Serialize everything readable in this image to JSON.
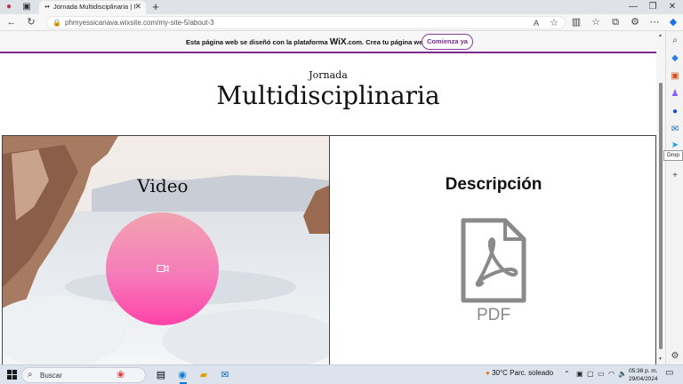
{
  "browser": {
    "tab_title": "Jornada Multidisciplinaria | My S",
    "url": "phmyessicanava.wixsite.com/my-site-5/about-3",
    "tooltip": "Drop"
  },
  "wix_banner": {
    "text_before": "Esta página web se diseñó con la plataforma ",
    "brand": "WiX",
    "text_after": ".com. Crea tu página web hoy.",
    "cta": "Comienza ya"
  },
  "page": {
    "kicker": "Jornada",
    "title": "Multidisciplinaria",
    "video_panel": {
      "title": "Video",
      "icon": "video-camera-icon"
    },
    "desc_panel": {
      "title": "Descripción",
      "file_label": "PDF",
      "icon": "pdf-file-icon"
    }
  },
  "taskbar": {
    "search_placeholder": "Buscar",
    "weather": "30°C  Parc. soleado",
    "time": "05:38 p. m.",
    "date": "29/04/2024"
  },
  "colors": {
    "wix_accent": "#7b2a8c",
    "circle_top": "#f2a3b0",
    "circle_bottom": "#ff43a8"
  }
}
